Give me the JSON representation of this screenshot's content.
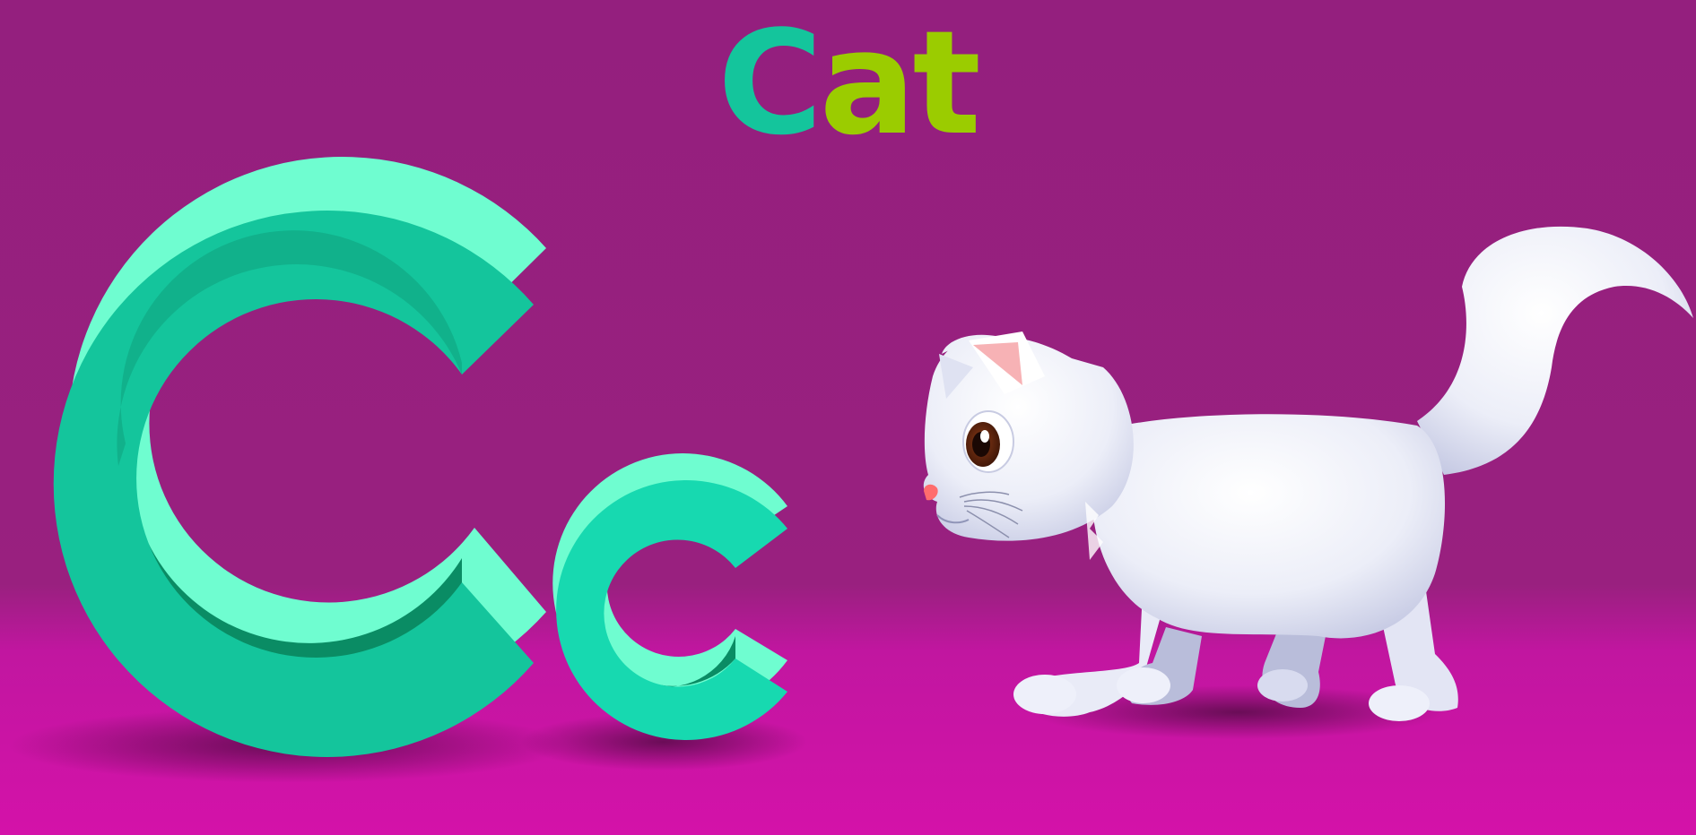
{
  "title": {
    "first_letter": "C",
    "rest": "at"
  },
  "colors": {
    "background_top": "#941f7e",
    "background_floor": "#d412a9",
    "letter_teal": "#14c59c",
    "letter_teal_light": "#6ffdd0",
    "letter_teal_dark": "#0a8c64",
    "title_green": "#9bcc00",
    "cat_white": "#f3f4fb",
    "cat_shade": "#b9bdda",
    "eye_brown": "#6a2a12",
    "nose_pink": "#ff6d6d"
  },
  "illustration": {
    "uppercase_letter": "C",
    "lowercase_letter": "c",
    "animal": "cat"
  }
}
